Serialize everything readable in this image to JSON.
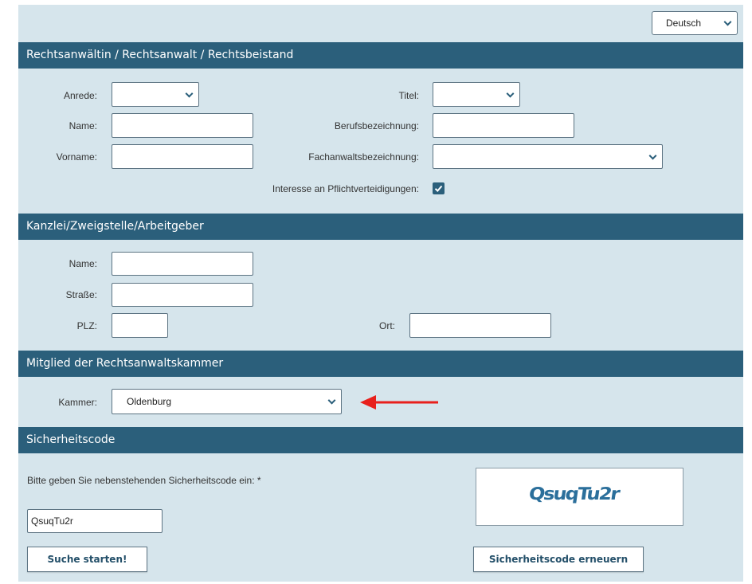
{
  "language": {
    "selected": "Deutsch"
  },
  "sections": {
    "lawyer": "Rechtsanwältin / Rechtsanwalt / Rechtsbeistand",
    "office": "Kanzlei/Zweigstelle/Arbeitgeber",
    "chamber": "Mitglied der Rechtsanwaltskammer",
    "security": "Sicherheitscode"
  },
  "lawyer": {
    "anrede_label": "Anrede:",
    "anrede_value": "",
    "titel_label": "Titel:",
    "titel_value": "",
    "name_label": "Name:",
    "name_value": "",
    "berufsbezeichnung_label": "Berufsbezeichnung:",
    "berufsbezeichnung_value": "",
    "vorname_label": "Vorname:",
    "vorname_value": "",
    "fachanwalt_label": "Fachanwaltsbezeichnung:",
    "fachanwalt_value": "",
    "pflicht_label": "Interesse an Pflichtverteidigungen:",
    "pflicht_checked": true
  },
  "office": {
    "name_label": "Name:",
    "name_value": "",
    "strasse_label": "Straße:",
    "strasse_value": "",
    "plz_label": "PLZ:",
    "plz_value": "",
    "ort_label": "Ort:",
    "ort_value": ""
  },
  "chamber": {
    "kammer_label": "Kammer:",
    "kammer_value": "Oldenburg",
    "arrow_color": "#e8201c"
  },
  "security": {
    "prompt": "Bitte geben Sie nebenstehenden Sicherheitscode ein: *",
    "code_value": "QsuqTu2r",
    "captcha_text": "QsuqTu2r",
    "search_button": "Suche starten!",
    "renew_button": "Sicherheitscode erneuern"
  },
  "colors": {
    "header_bg": "#2b5f7b",
    "panel_bg": "#d6e5ec",
    "captcha_ink": "#2b6f9b"
  }
}
